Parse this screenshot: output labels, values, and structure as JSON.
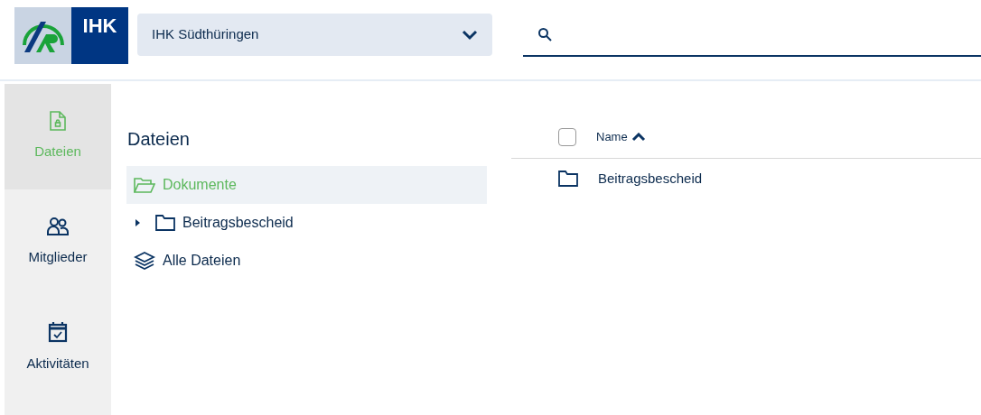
{
  "logo": {
    "text": "IHK"
  },
  "org_select": {
    "value": "IHK Südthüringen"
  },
  "nav": [
    {
      "label": "Dateien",
      "selected": true
    },
    {
      "label": "Mitglieder",
      "selected": false
    },
    {
      "label": "Aktivitäten",
      "selected": false
    }
  ],
  "panel": {
    "title": "Dateien",
    "tree": [
      {
        "label": "Dokumente",
        "kind": "folder",
        "selected": true,
        "open": true
      },
      {
        "label": "Beitragsbescheid",
        "kind": "folder",
        "selected": false,
        "open": false,
        "expanded": false
      },
      {
        "label": "Alle Dateien",
        "kind": "layers",
        "selected": false
      }
    ]
  },
  "table": {
    "select_all": {
      "checked": false
    },
    "columns": [
      {
        "label": "Name",
        "sort_ascending": true
      }
    ],
    "rows": [
      {
        "name": "Beitragsbescheid"
      }
    ]
  }
}
